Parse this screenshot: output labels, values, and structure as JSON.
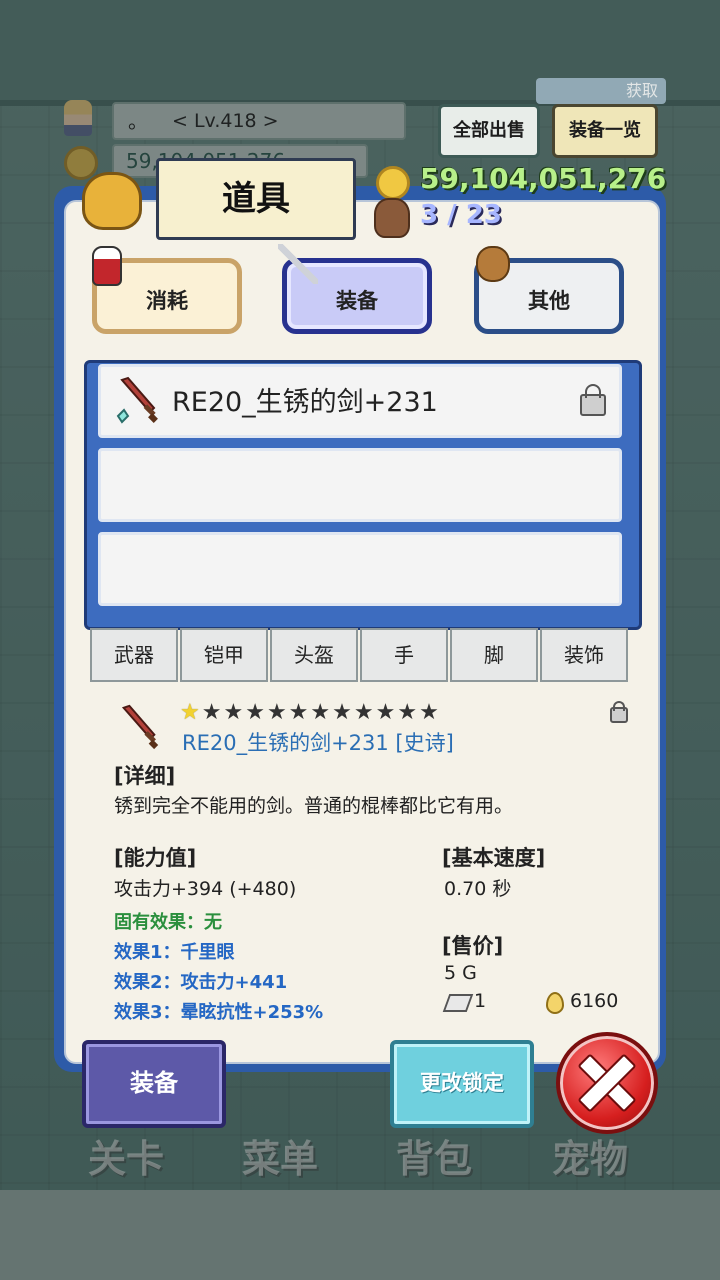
{
  "status": {
    "level_marker": "。",
    "level": "< Lv.418 >",
    "gold_small": "59,104,051,276",
    "gold": "59,104,051,276",
    "bag_capacity": "3 / 23"
  },
  "top_buttons": {
    "sell_all": "全部出售",
    "equip_list": "装备一览",
    "acquire": "获取"
  },
  "panel": {
    "title": "道具",
    "categories": [
      {
        "label": "消耗",
        "icon": "potion-icon"
      },
      {
        "label": "装备",
        "icon": "sword-icon",
        "selected": true
      },
      {
        "label": "其他",
        "icon": "bag-icon"
      }
    ],
    "items": [
      {
        "name": "RE20_生锈的剑+231",
        "icon": "rusty-sword-icon",
        "locked": true
      },
      {
        "name": ""
      },
      {
        "name": ""
      }
    ],
    "filters": [
      "武器",
      "铠甲",
      "头盔",
      "手",
      "脚",
      "装饰"
    ]
  },
  "detail": {
    "stars_filled": 1,
    "stars_total": 12,
    "name": "RE20_生锈的剑+231 [史诗]",
    "desc_header": "[详细]",
    "description": "锈到完全不能用的剑。普通的棍棒都比它有用。",
    "stats_header": "[能力值]",
    "attack": "攻击力+394 (+480)",
    "inherent": "固有效果：无",
    "effect1": "效果1：千里眼",
    "effect2": "效果2：攻击力+441",
    "effect3": "效果3：晕眩抗性+253%",
    "speed_header": "[基本速度]",
    "speed": "0.70 秒",
    "price_header": "[售价]",
    "price": "5 G",
    "stone_count": "1",
    "drop_count": "6160"
  },
  "actions": {
    "equip": "装备",
    "change_lock": "更改锁定"
  },
  "nav": [
    "关卡",
    "菜单",
    "背包",
    "宠物"
  ],
  "colors": {
    "panel_border": "#2d5ba8",
    "gold_text": "#b8f08a",
    "rarity_text": "#2a6eb4",
    "effect_text": "#2467c4",
    "inherent_text": "#2a8f3d"
  }
}
